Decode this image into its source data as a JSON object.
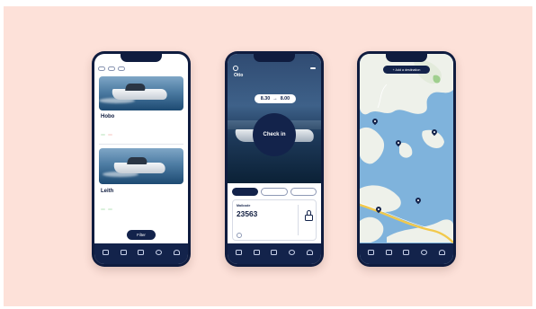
{
  "phone1": {
    "chips": [
      "",
      "",
      ""
    ],
    "listings": [
      {
        "title": "Hobo",
        "subtitle": "",
        "detail": "",
        "tags": [
          "",
          ""
        ]
      },
      {
        "title": "Leith",
        "subtitle": "",
        "detail": "",
        "tags": [
          "",
          ""
        ]
      }
    ],
    "filter_label": "Filter",
    "tabs": [
      "",
      "",
      "",
      "",
      ""
    ]
  },
  "phone2": {
    "help_label": "",
    "name": "Otto",
    "name_sub": "",
    "weather": "",
    "weather_sub": "",
    "time_label_from": "",
    "time_label_to": "",
    "time_from": "8.30",
    "time_arrow": "→",
    "time_to": "8.00",
    "checkin_label": "Check in",
    "note": "",
    "tabs": [
      "",
      "",
      ""
    ],
    "card": {
      "label": "Mailcode",
      "code": "23563",
      "description": "",
      "lock_text": ""
    },
    "tabs_bottom": [
      "",
      "",
      "",
      "",
      ""
    ]
  },
  "phone3": {
    "add_destination": "+ Add a destination",
    "tabs": [
      "",
      "",
      "",
      "",
      ""
    ]
  },
  "colors": {
    "navy": "#13234b",
    "background": "#fde1d9",
    "water": "#7fb3dc",
    "land": "#eef1ea"
  }
}
